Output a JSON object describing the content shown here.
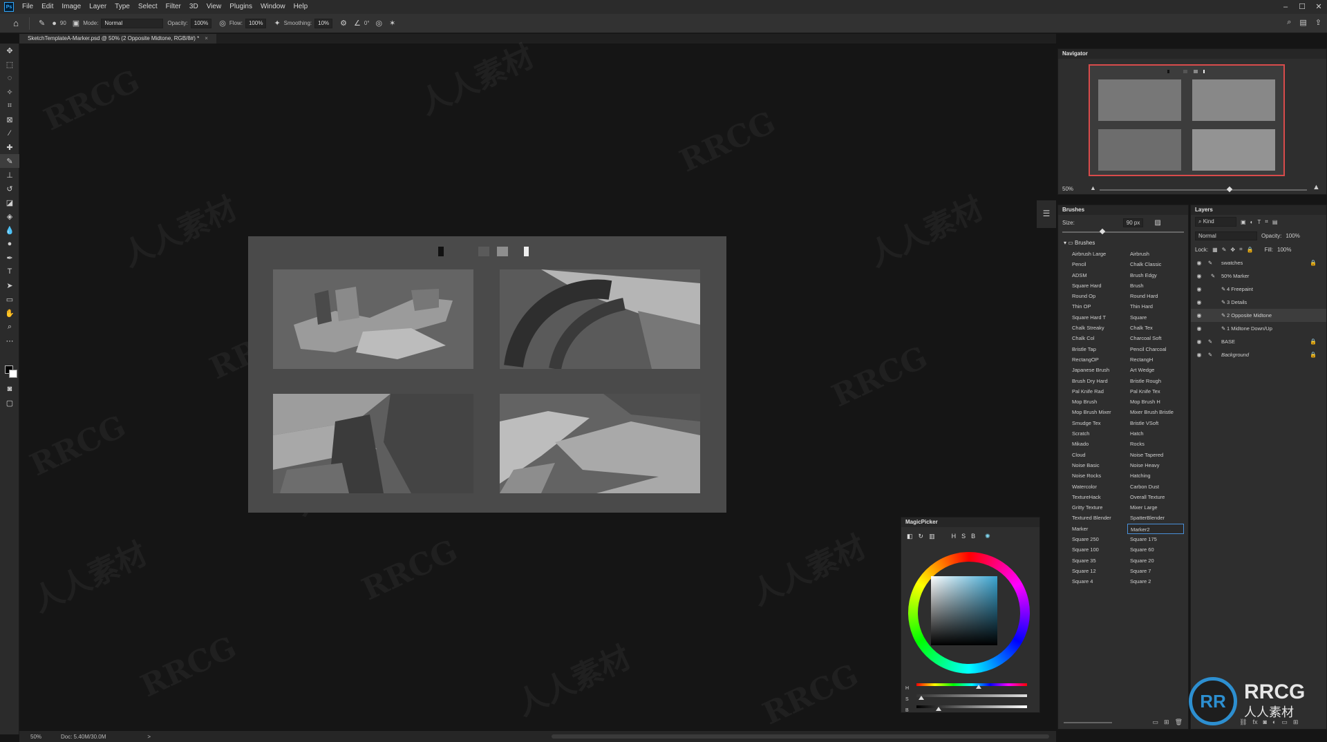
{
  "menubar": {
    "logo": "Ps",
    "items": [
      "File",
      "Edit",
      "Image",
      "Layer",
      "Type",
      "Select",
      "Filter",
      "3D",
      "View",
      "Plugins",
      "Window",
      "Help"
    ]
  },
  "options": {
    "brush_size": "90",
    "mode_label": "Mode:",
    "mode_value": "Normal",
    "opacity_label": "Opacity:",
    "opacity_value": "100%",
    "flow_label": "Flow:",
    "flow_value": "100%",
    "smoothing_label": "Smoothing:",
    "smoothing_value": "10%",
    "angle_value": "0°"
  },
  "document": {
    "tab_title": "SketchTemplateA-Marker.psd @ 50% (2 Opposite Midtone, RGB/8#) *",
    "close": "×"
  },
  "status": {
    "zoom": "50%",
    "doc_info": "Doc: 5.40M/30.0M",
    "arrow": ">"
  },
  "navigator": {
    "title": "Navigator",
    "zoom": "50%"
  },
  "brushes": {
    "title": "Brushes",
    "size_label": "Size:",
    "size_value": "90 px",
    "folder": "Brushes",
    "left": [
      "Airbrush Large",
      "Pencil",
      "ADSM",
      "Square Hard",
      "Round Op",
      "Thin OP",
      "Square Hard T",
      "Chalk Streaky",
      "Chalk Col",
      "Bristle Tap",
      "RectangOP",
      "Japanese Brush",
      "Brush Dry Hard",
      "Pal Knife Rad",
      "Mop Brush",
      "Mop Brush Mixer",
      "Smudge Tex",
      "Scratch",
      "Mikado",
      "Cloud",
      "Noise Basic",
      "Noise Rocks",
      "Watercolor",
      "TextureHack",
      "Gritty Texture",
      "Textured Blender",
      "Marker",
      "Square 250",
      "Square 100",
      "Square 35",
      "Square 12",
      "Square 4"
    ],
    "right": [
      "Airbrush",
      "Chalk Classic",
      "Brush Edgy",
      "Brush",
      "Round Hard",
      "Thin Hard",
      "Square",
      "Chalk Tex",
      "Charcoal Soft",
      "Pencil Charcoal",
      "RectangH",
      "Art Wedge",
      "Bristle Rough",
      "Pal Knife Tex",
      "Mop Brush H",
      "Mixer Brush Bristle",
      "Bristle VSoft",
      "Hatch",
      "Rocks",
      "Noise Tapered",
      "Noise Heavy",
      "Hatching",
      "Carbon Dust",
      "Overall Texture",
      "Mixer Large",
      "SpatterBlender",
      "Marker2",
      "Square 175",
      "Square 60",
      "Square 20",
      "Square 7",
      "Square 2"
    ],
    "selected": "Marker2"
  },
  "layers": {
    "title": "Layers",
    "kind": "Kind",
    "blend": "Normal",
    "opacity_label": "Opacity:",
    "opacity_value": "100%",
    "lock_label": "Lock:",
    "fill_label": "Fill:",
    "fill_value": "100%",
    "items": [
      {
        "name": "swatches",
        "locked": true
      },
      {
        "name": "50% Marker",
        "locked": false
      },
      {
        "name": "4 Freepaint",
        "locked": false
      },
      {
        "name": "3 Details",
        "locked": false
      },
      {
        "name": "2 Opposite Midtone",
        "locked": false
      },
      {
        "name": "1 Midtone Down/Up",
        "locked": false
      },
      {
        "name": "BASE",
        "locked": true
      },
      {
        "name": "Background",
        "locked": true
      }
    ],
    "selected": "2 Opposite Midtone"
  },
  "magicpicker": {
    "title": "MagicPicker",
    "modes": [
      "H",
      "S",
      "B"
    ],
    "slider_labels": [
      "H",
      "S",
      "B"
    ],
    "hue_level": 0.55,
    "sat_level": 0.02,
    "bri_level": 0.18,
    "accent": "#3aa4d0"
  },
  "watermark": {
    "text_en": "RRCG",
    "text_cn": "人人素材"
  },
  "logo": {
    "mark": "RR",
    "brand": "RRCG",
    "sub": "人人素材"
  },
  "colors": {
    "ui_dark": "#2b2b2b",
    "canvas_bg": "#151515",
    "navigator_frame": "#d94b4b",
    "selection_blue": "#4a90d9"
  }
}
